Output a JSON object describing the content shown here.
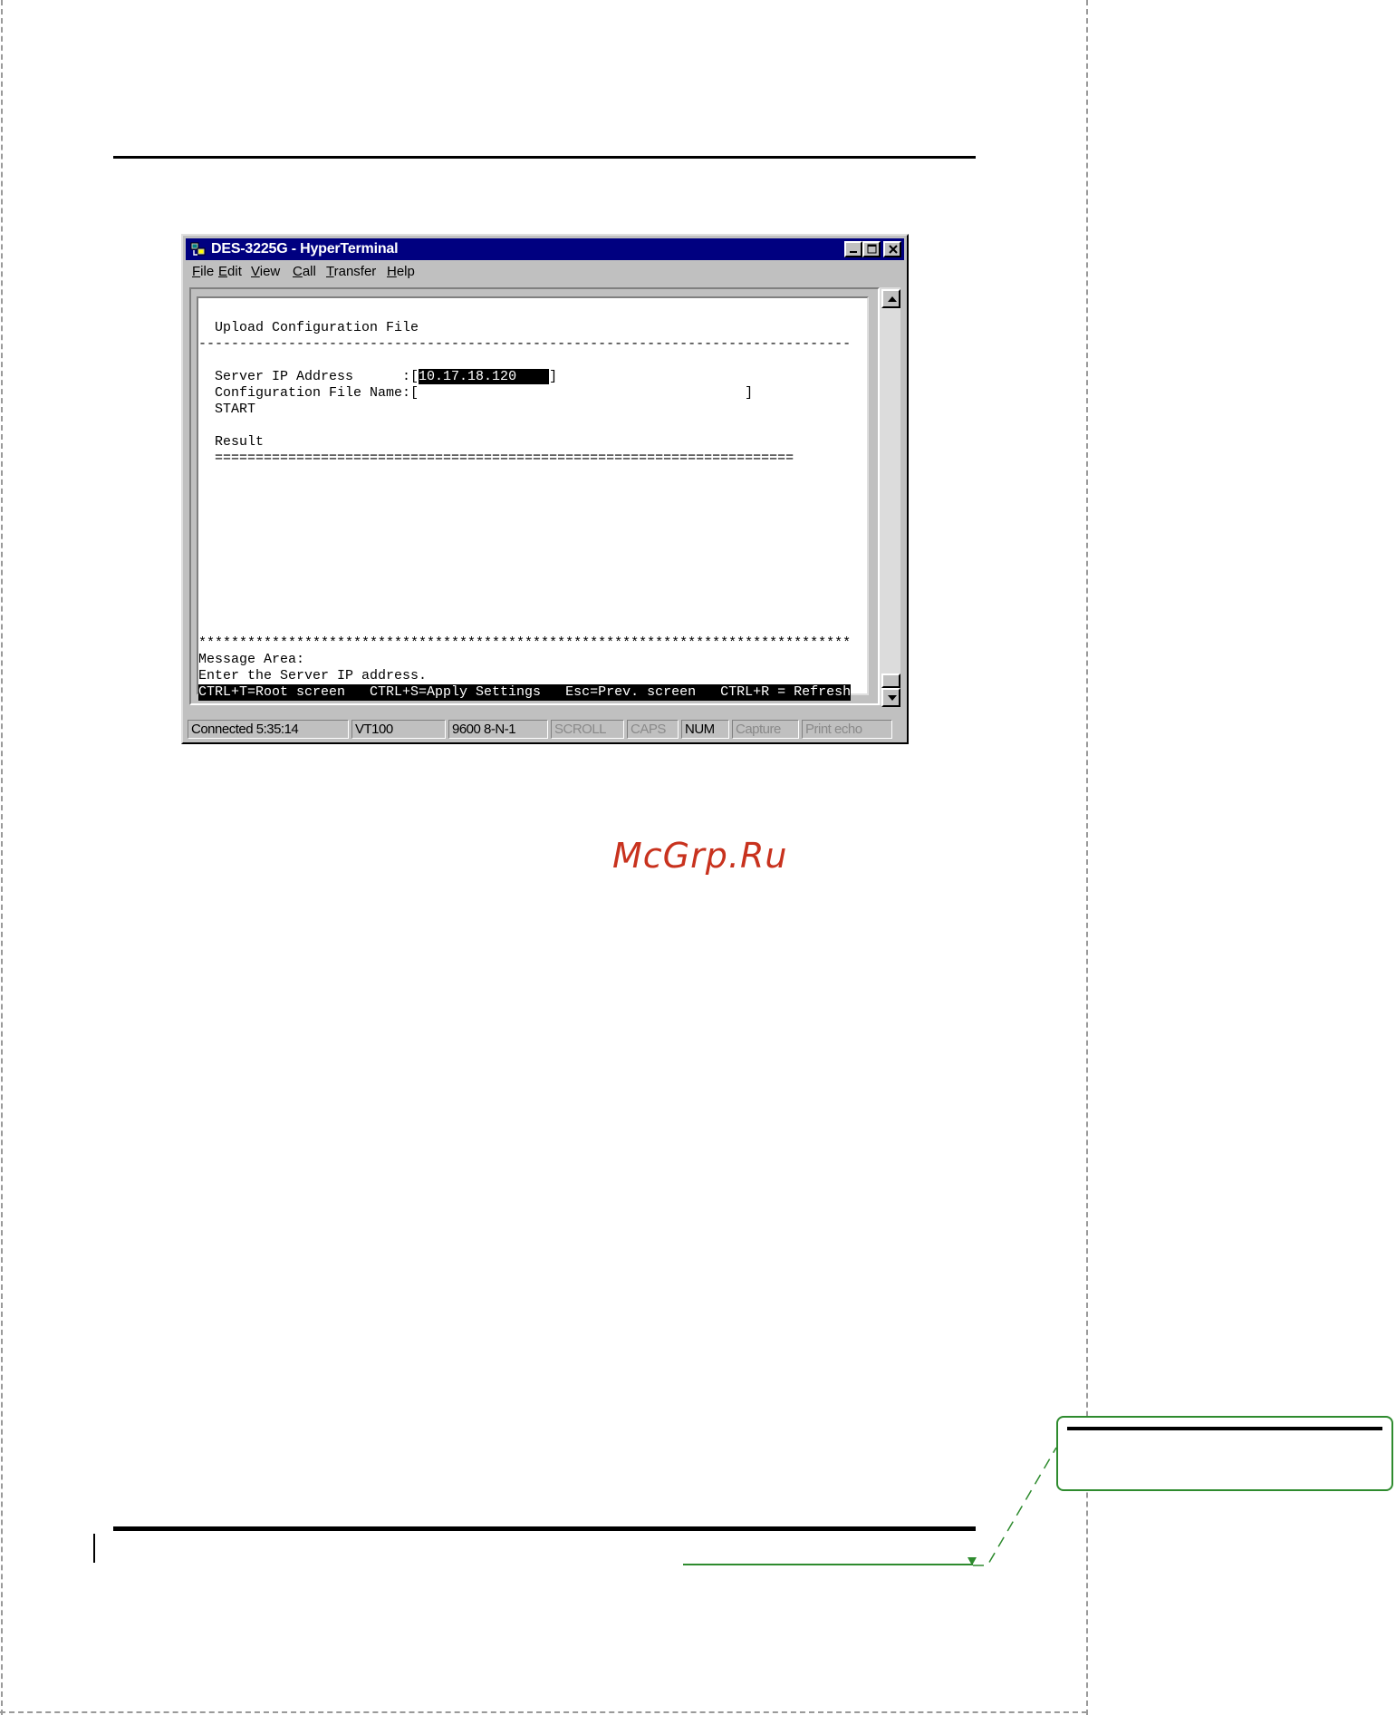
{
  "watermark": "McGrp.Ru",
  "window": {
    "title": "DES-3225G - HyperTerminal",
    "menu": [
      {
        "label": "File",
        "accel": "F",
        "rest": "ile"
      },
      {
        "label": "Edit",
        "accel": "E",
        "rest": "dit"
      },
      {
        "label": "View",
        "accel": "V",
        "rest": "iew"
      },
      {
        "label": "Call",
        "accel": "C",
        "rest": "all"
      },
      {
        "label": "Transfer",
        "accel": "T",
        "rest": "ransfer"
      },
      {
        "label": "Help",
        "accel": "H",
        "rest": "elp"
      }
    ],
    "controls": [
      "minimize-icon",
      "maximize-icon",
      "close-icon"
    ]
  },
  "terminal": {
    "heading": "  Upload Configuration File",
    "divider": "--------------------------------------------------------------------------------",
    "server_ip_label": "  Server IP Address      :[",
    "server_ip_value": "10.17.18.120    ",
    "server_ip_close": "]",
    "config_file_label": "  Configuration File Name:[",
    "config_file_value": "                                        ",
    "config_file_close": "]",
    "start": "  START",
    "result_label": "  Result",
    "result_divider": "  =======================================================================",
    "stars": "********************************************************************************",
    "message_area": "Message Area:",
    "message": "Enter the Server IP address.",
    "hotkeys": "CTRL+T=Root screen   CTRL+S=Apply Settings   Esc=Prev. screen   CTRL+R = Refresh"
  },
  "statusbar": {
    "connected": "Connected 5:35:14",
    "emulation": "VT100",
    "port": "9600 8-N-1",
    "scroll": "SCROLL",
    "caps": "CAPS",
    "num": "NUM",
    "capture": "Capture",
    "print_echo": "Print echo"
  },
  "colors": {
    "titlebar": "#000080",
    "accent_green": "#2e8b2e",
    "watermark": "#c8321e"
  }
}
